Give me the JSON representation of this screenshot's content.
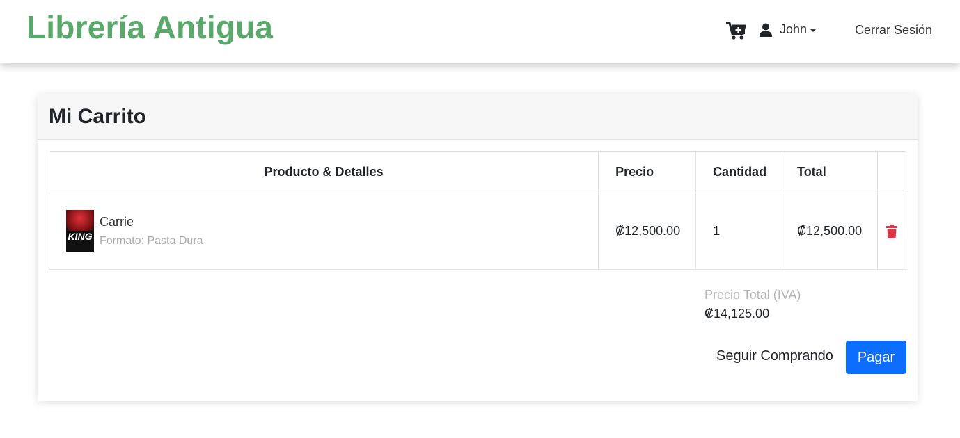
{
  "nav": {
    "brand": "Librería Antigua",
    "user_name": "John",
    "logout_label": "Cerrar Sesión"
  },
  "cart": {
    "title": "Mi Carrito",
    "headers": {
      "product": "Producto & Detalles",
      "price": "Precio",
      "quantity": "Cantidad",
      "total": "Total"
    },
    "items": [
      {
        "name": "Carrie",
        "format": "Formato: Pasta Dura",
        "price": "₡12,500.00",
        "quantity": "1",
        "total": "₡12,500.00",
        "cover_text": "KING"
      }
    ],
    "total_label": "Precio Total (IVA)",
    "total_value": "₡14,125.00",
    "continue_label": "Seguir Comprando",
    "pay_label": "Pagar"
  },
  "colors": {
    "brand": "#5aa86b",
    "primary": "#0d6efd",
    "danger": "#dc3545"
  },
  "icons": [
    "cart-plus-icon",
    "user-icon",
    "caret-down-icon",
    "trash-icon"
  ]
}
